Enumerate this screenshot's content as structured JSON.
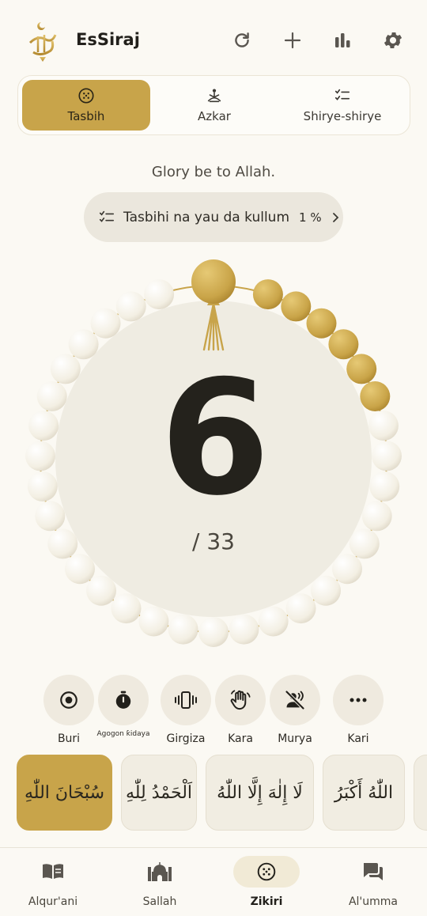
{
  "header": {
    "title": "EsSiraj",
    "logo_text": "سراج"
  },
  "modes": [
    {
      "label": "Tasbih",
      "icon": "prayer-beads-icon",
      "active": true
    },
    {
      "label": "Azkar",
      "icon": "meditation-icon",
      "active": false
    },
    {
      "label": "Shirye-shirye",
      "icon": "checklist-icon",
      "active": false
    }
  ],
  "subtitle": "Glory be to Allah.",
  "progress_pill": {
    "text": "Tasbihi na yau da kullum",
    "percent": "1 %"
  },
  "counter": {
    "count": "6",
    "target": "/ 33",
    "filled_beads": 6,
    "total_beads": 33
  },
  "controls": [
    {
      "label": "Buri",
      "icon": "target-icon",
      "active": false
    },
    {
      "label": "Agogon ƙidaya",
      "icon": "stopwatch-icon",
      "active": false
    },
    {
      "label": "Girgiza",
      "icon": "vibrate-icon",
      "active": true
    },
    {
      "label": "Kara",
      "icon": "hand-wave-icon",
      "active": false
    },
    {
      "label": "Murya",
      "icon": "voice-off-icon",
      "active": false
    },
    {
      "label": "Kari",
      "icon": "more-icon",
      "active": false
    }
  ],
  "dhikr_cards": [
    {
      "text": "سُبْحَانَ اللّٰهِ",
      "active": true
    },
    {
      "text": "اَلْحَمْدُ لِلّٰهِ",
      "active": false
    },
    {
      "text": "لَا إِلٰهَ إِلَّا اللّٰهُ",
      "active": false
    },
    {
      "text": "اللّٰهُ أَكْبَرُ",
      "active": false
    }
  ],
  "nav": [
    {
      "label": "Alqur'ani",
      "icon": "book-icon",
      "active": false
    },
    {
      "label": "Sallah",
      "icon": "mosque-icon",
      "active": false
    },
    {
      "label": "Zikiri",
      "icon": "prayer-beads-icon",
      "active": true
    },
    {
      "label": "Al'umma",
      "icon": "chat-icon",
      "active": false
    }
  ],
  "colors": {
    "accent": "#c8a44a",
    "bead": "#f6f2e6",
    "background": "#fbf9f3"
  }
}
